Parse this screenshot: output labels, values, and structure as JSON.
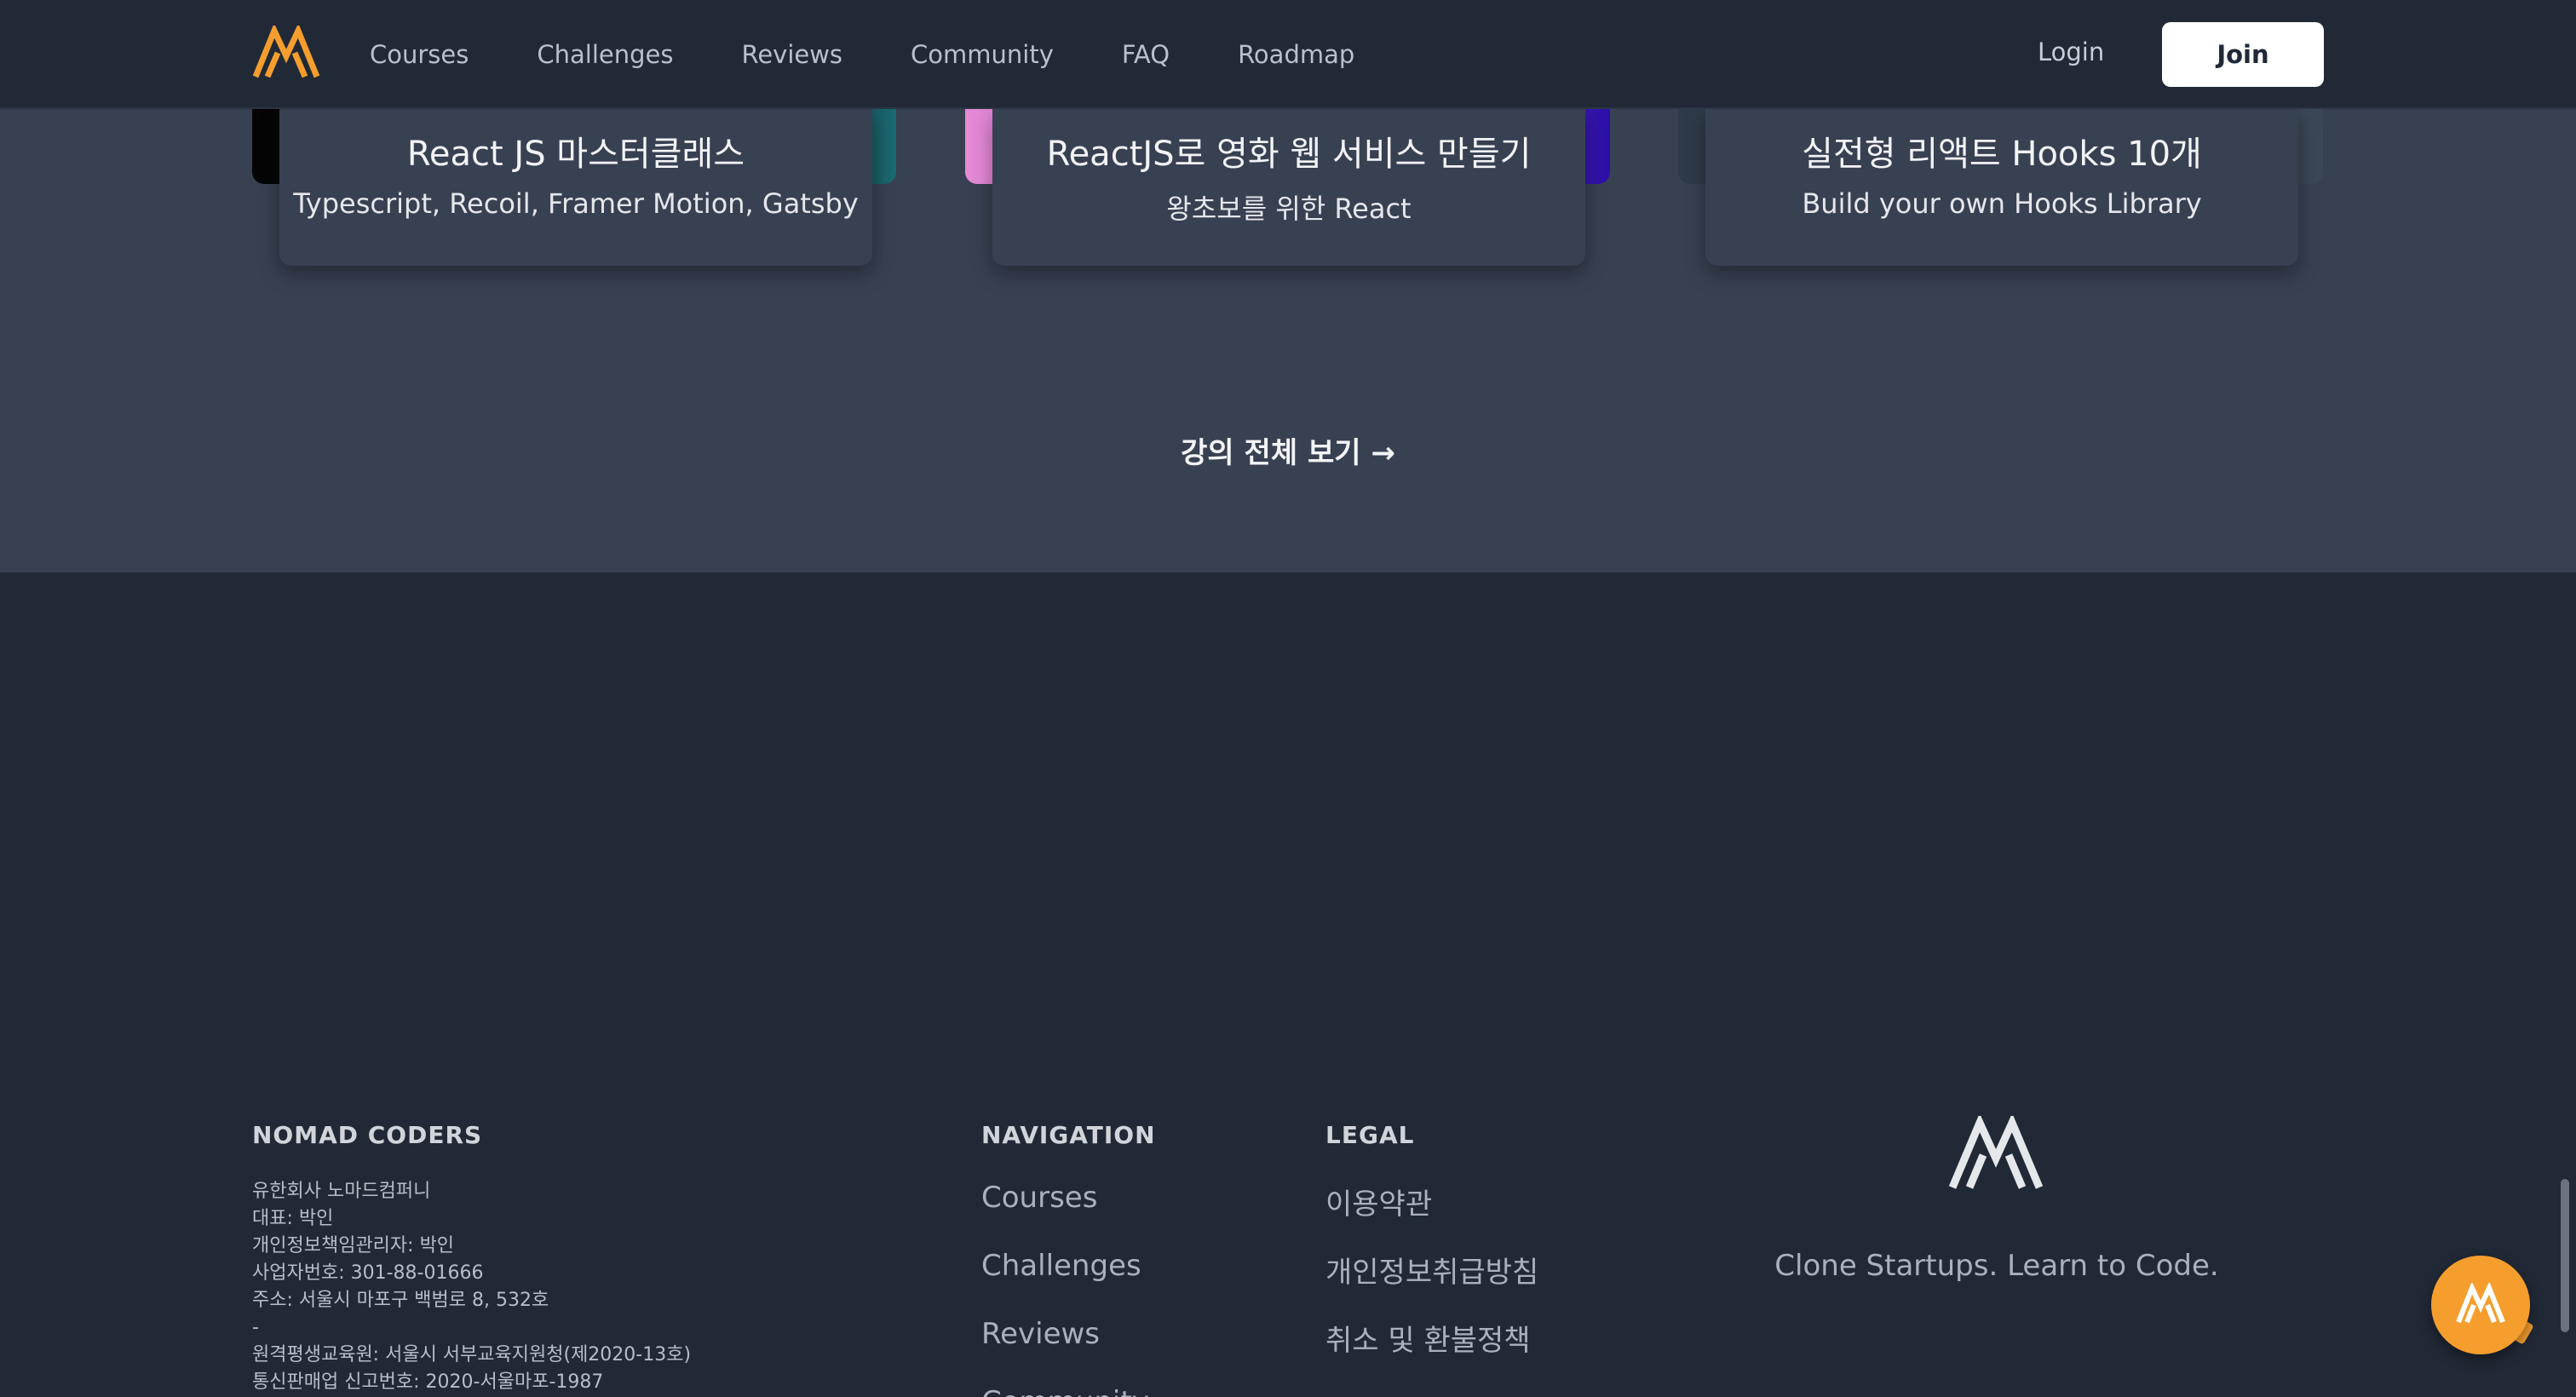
{
  "header": {
    "nav": [
      "Courses",
      "Challenges",
      "Reviews",
      "Community",
      "FAQ",
      "Roadmap"
    ],
    "login": "Login",
    "join": "Join"
  },
  "courses": {
    "cards": [
      {
        "title": "React JS 마스터클래스",
        "subtitle": "Typescript, Recoil, Framer Motion, Gatsby"
      },
      {
        "title": "ReactJS로 영화 웹 서비스 만들기",
        "subtitle": "왕초보를 위한 React"
      },
      {
        "title": "실전형 리액트 Hooks 10개",
        "subtitle": "Build your own Hooks Library"
      }
    ],
    "see_all": "강의 전체 보기 →"
  },
  "footer": {
    "company_heading": "NOMAD CODERS",
    "company_lines": [
      "유한회사 노마드컴퍼니",
      "대표: 박인",
      "개인정보책임관리자: 박인",
      "사업자번호: 301-88-01666",
      "주소: 서울시 마포구 백범로 8, 532호",
      "-",
      "원격평생교육원: 서울시 서부교육지원청(제2020-13호)",
      "통신판매업 신고번호: 2020-서울마포-1987"
    ],
    "navigation_heading": "NAVIGATION",
    "navigation_links": [
      "Courses",
      "Challenges",
      "Reviews",
      "Community"
    ],
    "legal_heading": "LEGAL",
    "legal_links": [
      "이용약관",
      "개인정보취급방침",
      "취소 및 환불정책"
    ],
    "tagline": "Clone Startups. Learn to Code."
  },
  "colors": {
    "brand_orange": "#f59e2e",
    "header_bg": "#212936",
    "band_bg": "#384152"
  }
}
